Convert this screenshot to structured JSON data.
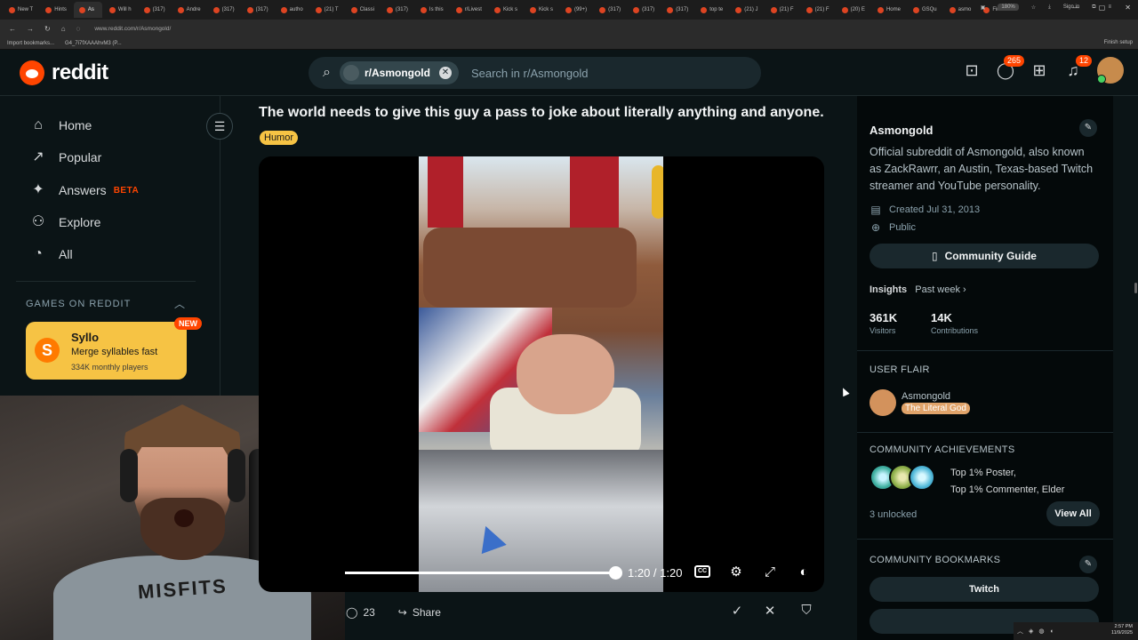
{
  "browser": {
    "tabs": [
      {
        "label": "New T",
        "active": false
      },
      {
        "label": "Hints",
        "active": false
      },
      {
        "label": "As",
        "active": true
      },
      {
        "label": "Will h",
        "active": false
      },
      {
        "label": "(317)",
        "active": false
      },
      {
        "label": "Andre",
        "active": false
      },
      {
        "label": "(317)",
        "active": false
      },
      {
        "label": "(317)",
        "active": false
      },
      {
        "label": "autho",
        "active": false
      },
      {
        "label": "(21) T",
        "active": false
      },
      {
        "label": "Classi",
        "active": false
      },
      {
        "label": "(317)",
        "active": false
      },
      {
        "label": "Is this",
        "active": false
      },
      {
        "label": "r/Livest",
        "active": false
      },
      {
        "label": "Kick s",
        "active": false
      },
      {
        "label": "Kick s",
        "active": false
      },
      {
        "label": "(99+)",
        "active": false
      },
      {
        "label": "(317)",
        "active": false
      },
      {
        "label": "(317)",
        "active": false
      },
      {
        "label": "(317)",
        "active": false
      },
      {
        "label": "top te",
        "active": false
      },
      {
        "label": "(21) J",
        "active": false
      },
      {
        "label": "(21) F",
        "active": false
      },
      {
        "label": "(21) F",
        "active": false
      },
      {
        "label": "(20) E",
        "active": false
      },
      {
        "label": "Home",
        "active": false
      },
      {
        "label": "GSQu",
        "active": false
      },
      {
        "label": "asmo",
        "active": false
      },
      {
        "label": "Find S",
        "active": false
      }
    ],
    "url": "www.reddit.com/r/Asmongold/",
    "zoom": "180%",
    "sign_in": "Sign in",
    "bookmarks": [
      "Import bookmarks...",
      "G4_7i7fXAAAhvM3 (P..."
    ],
    "finish_setup": "Finish setup"
  },
  "header": {
    "logo_text": "reddit",
    "search_chip": "r/Asmongold",
    "search_placeholder": "Search in r/Asmongold",
    "chat_badge": "265",
    "notif_badge": "12"
  },
  "sidebar": {
    "items": [
      {
        "label": "Home",
        "icon": "home-icon"
      },
      {
        "label": "Popular",
        "icon": "popular-icon"
      },
      {
        "label": "Answers",
        "icon": "answers-icon",
        "tag": "BETA"
      },
      {
        "label": "Explore",
        "icon": "explore-icon"
      },
      {
        "label": "All",
        "icon": "all-icon"
      }
    ],
    "games_header": "GAMES ON REDDIT",
    "game": {
      "title": "Syllo",
      "subtitle": "Merge syllables fast",
      "players": "334K monthly players",
      "badge": "NEW",
      "logo_letter": "S"
    }
  },
  "post": {
    "title": "The world needs to give this guy a pass to joke about literally anything and anyone.",
    "flair": "Humor",
    "video": {
      "time": "1:20 / 1:20",
      "progress": 1.0,
      "cc": "CC"
    },
    "comments": "23",
    "share": "Share"
  },
  "right_sidebar": {
    "name": "Asmongold",
    "description": "Official subreddit of Asmongold, also known as ZackRawrr, an Austin, Texas-based Twitch streamer and YouTube personality.",
    "created": "Created Jul 31, 2013",
    "visibility": "Public",
    "guide_button": "Community Guide",
    "insights_label": "Insights",
    "insights_period": "Past week ›",
    "visitors": {
      "value": "361K",
      "label": "Visitors"
    },
    "contributions": {
      "value": "14K",
      "label": "Contributions"
    },
    "user_flair_header": "USER FLAIR",
    "flair_user": "Asmongold",
    "flair_tag": "The Literal God",
    "achievements_header": "COMMUNITY ACHIEVEMENTS",
    "achievements_line1": "Top 1% Poster,",
    "achievements_line2": "Top 1% Commenter, Elder",
    "unlocked": "3 unlocked",
    "view_all": "View All",
    "bookmarks_header": "COMMUNITY BOOKMARKS",
    "bookmark_button": "Twitch"
  },
  "webcam": {
    "shirt_text": "MISFITS"
  },
  "taskbar": {
    "time": "2:57 PM",
    "date": "11/9/2025"
  },
  "colors": {
    "reddit_orange": "#ff4500",
    "flair_yellow": "#f6c344",
    "bg": "#0b1416"
  }
}
